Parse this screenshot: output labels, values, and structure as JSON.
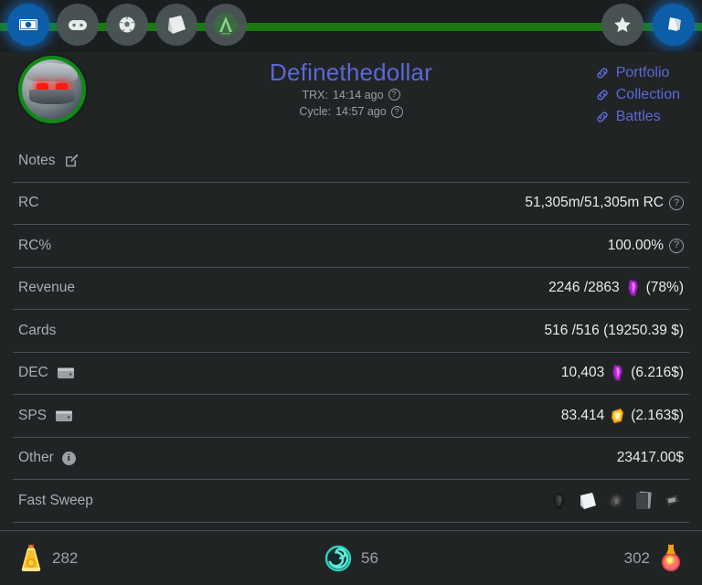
{
  "theme": {
    "background": "#212425",
    "topbar_bg": "#1b1e1f",
    "rail_green": "#1a7a0f",
    "accent_blue": "#0d5ea8",
    "link_purple": "#5b68d6",
    "label_gray": "#a7aeb1",
    "value_white": "#e8eaeb",
    "divider": "#4a4f51",
    "avatar_ring_green": "#0e8a15"
  },
  "topnav": {
    "left_items": [
      {
        "name": "cash-icon",
        "state": "active"
      },
      {
        "name": "gamepad-icon",
        "state": "inactive"
      },
      {
        "name": "soccer-ball-icon",
        "state": "inactive"
      },
      {
        "name": "card-pack-icon",
        "state": "inactive"
      },
      {
        "name": "arena-a-icon",
        "state": "inactive"
      }
    ],
    "right_items": [
      {
        "name": "star-icon",
        "state": "inactive"
      },
      {
        "name": "cards-stack-icon",
        "state": "active"
      }
    ]
  },
  "header": {
    "avatar_name": "robot-avatar",
    "title": "Definethedollar",
    "meta": [
      {
        "label": "TRX:",
        "value": "14:14 ago",
        "help": "?"
      },
      {
        "label": "Cycle:",
        "value": "14:57 ago",
        "help": "?"
      }
    ],
    "links": [
      {
        "label": "Portfolio"
      },
      {
        "label": "Collection"
      },
      {
        "label": "Battles"
      }
    ]
  },
  "rows": [
    {
      "label": "Notes",
      "label_icon": "edit-pencil-icon",
      "value": ""
    },
    {
      "label": "RC",
      "value": "51,305m/51,305m RC",
      "help": "?"
    },
    {
      "label": "RC%",
      "value": "100.00%",
      "help": "?"
    },
    {
      "label": "Revenue",
      "value": "2246 /2863",
      "token": "dec-token-icon",
      "suffix": "(78%)"
    },
    {
      "label": "Cards",
      "value": "516 /516 (19250.39 $)"
    },
    {
      "label": "DEC",
      "label_icon": "wallet-icon",
      "value": "10,403",
      "token": "dec-token-icon",
      "suffix": "(6.216$)"
    },
    {
      "label": "SPS",
      "label_icon": "wallet-icon",
      "value": "83.414",
      "token": "sps-token-icon",
      "suffix": "(2.163$)"
    },
    {
      "label": "Other",
      "label_icon": "info-icon",
      "value": "23417.00$"
    },
    {
      "label": "Fast Sweep",
      "sweep_icons": [
        "glove-item-icon",
        "white-pack-icon",
        "ore-item-icon",
        "card-stack-item-icon",
        "chest-item-icon"
      ]
    }
  ],
  "bottombar": {
    "left": {
      "icon": "gold-potion-icon",
      "value": "282"
    },
    "middle": {
      "icon": "teal-spiral-icon",
      "value": "56"
    },
    "right": {
      "icon": "red-potion-icon",
      "value": "302"
    }
  }
}
